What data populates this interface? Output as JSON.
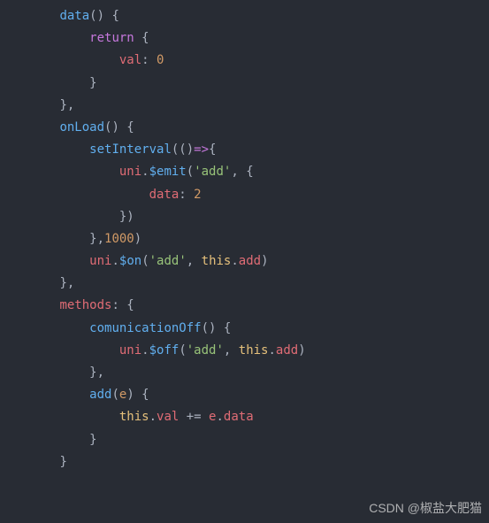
{
  "code": {
    "line1": {
      "indent": "        ",
      "t1": "data",
      "t2": "() {"
    },
    "line2": {
      "indent": "            ",
      "t1": "return",
      "t2": " {"
    },
    "line3": {
      "indent": "                ",
      "t1": "val",
      "t2": ": ",
      "t3": "0"
    },
    "line4": {
      "indent": "            ",
      "t1": "}"
    },
    "line5": {
      "indent": "        ",
      "t1": "},"
    },
    "line6": {
      "indent": "        ",
      "t1": "onLoad",
      "t2": "() {"
    },
    "line7": {
      "indent": "            ",
      "t1": "setInterval",
      "t2": "(()",
      "t3": "=>",
      "t4": "{"
    },
    "line8": {
      "indent": "                ",
      "t1": "uni",
      "t2": ".",
      "t3": "$emit",
      "t4": "(",
      "t5": "'add'",
      "t6": ", {"
    },
    "line9": {
      "indent": "                    ",
      "t1": "data",
      "t2": ": ",
      "t3": "2"
    },
    "line10": {
      "indent": "                ",
      "t1": "})"
    },
    "line11": {
      "indent": "            ",
      "t1": "},",
      "t2": "1000",
      "t3": ")"
    },
    "line12": {
      "indent": "            ",
      "t1": "uni",
      "t2": ".",
      "t3": "$on",
      "t4": "(",
      "t5": "'add'",
      "t6": ", ",
      "t7": "this",
      "t8": ".",
      "t9": "add",
      "t10": ")"
    },
    "line13": {
      "indent": "        ",
      "t1": "},"
    },
    "line14": {
      "indent": "        ",
      "t1": "methods",
      "t2": ": {"
    },
    "line15": {
      "indent": "            ",
      "t1": "comunicationOff",
      "t2": "() {"
    },
    "line16": {
      "indent": "                ",
      "t1": "uni",
      "t2": ".",
      "t3": "$off",
      "t4": "(",
      "t5": "'add'",
      "t6": ", ",
      "t7": "this",
      "t8": ".",
      "t9": "add",
      "t10": ")"
    },
    "line17": {
      "indent": "            ",
      "t1": "},"
    },
    "line18": {
      "indent": "            ",
      "t1": "add",
      "t2": "(",
      "t3": "e",
      "t4": ") {"
    },
    "line19": {
      "indent": "                ",
      "t1": "this",
      "t2": ".",
      "t3": "val",
      "t4": " += ",
      "t5": "e",
      "t6": ".",
      "t7": "data"
    },
    "line20": {
      "indent": "            ",
      "t1": "}"
    },
    "line21": {
      "indent": "        ",
      "t1": "}"
    }
  },
  "watermark": "CSDN @椒盐大肥猫"
}
